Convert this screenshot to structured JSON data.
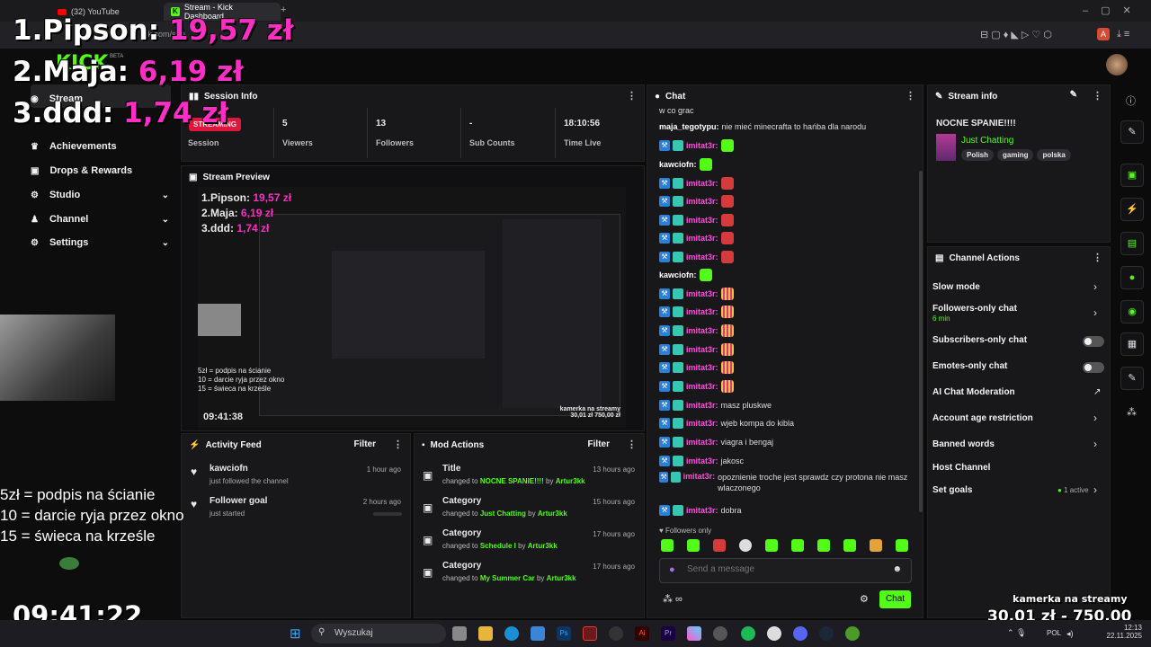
{
  "browser": {
    "tabs": [
      {
        "label": "(32) YouTube"
      },
      {
        "label": "Stream - Kick Dashboard"
      }
    ],
    "url_partial": "ck.com/stre"
  },
  "overlay": {
    "donors": [
      {
        "rank": "1.",
        "name": "Pipson:",
        "amount": "19,57 zł"
      },
      {
        "rank": "2.",
        "name": "Maja:",
        "amount": "6,19 zł"
      },
      {
        "rank": "3.",
        "name": "ddd:",
        "amount": "1,74 zł"
      }
    ],
    "rules": [
      "5zł = podpis na ścianie",
      "10 = darcie ryja przez okno",
      "15 = świeca na krześle"
    ],
    "clock": "09:41:22",
    "goal_title": "kamerka na streamy",
    "goal_current": "30,01 zł",
    "goal_sep": "-",
    "goal_target": "750,00 zł"
  },
  "sidebar": {
    "logo": "KICK",
    "logo_tag": "BETA",
    "items": [
      {
        "label": "Stream",
        "icon": "stream-icon",
        "expandable": false
      },
      {
        "label": "Achievements",
        "icon": "trophy-icon",
        "expandable": false
      },
      {
        "label": "Drops & Rewards",
        "icon": "gift-icon",
        "expandable": false
      },
      {
        "label": "Studio",
        "icon": "studio-icon",
        "expandable": true
      },
      {
        "label": "Channel",
        "icon": "channel-icon",
        "expandable": true
      },
      {
        "label": "Settings",
        "icon": "gear-icon",
        "expandable": true
      }
    ]
  },
  "session": {
    "title": "Session Info",
    "status": "STREAMING",
    "status_label": "Session",
    "stats": [
      {
        "value": "5",
        "label": "Viewers"
      },
      {
        "value": "13",
        "label": "Followers"
      },
      {
        "value": "-",
        "label": "Sub Counts"
      },
      {
        "value": "18:10:56",
        "label": "Time Live"
      }
    ]
  },
  "preview": {
    "title": "Stream Preview",
    "donors_mini": [
      "1.Pipson:",
      "2.Maja:",
      "3.ddd:"
    ],
    "amounts_mini": [
      "19,57 zł",
      "6,19 zł",
      "1,74 zł"
    ],
    "clock_mini": "09:41:38",
    "rules_mini": [
      "5zł = podpis na ścianie",
      "10 = darcie ryja przez okno",
      "15 = świeca na krześle"
    ],
    "goal_mini": "kamerka na streamy",
    "goal_amount_mini": "30,01 zł  750,00 zł"
  },
  "activity": {
    "title": "Activity Feed",
    "filter": "Filter",
    "items": [
      {
        "user": "kawciofn",
        "text": "just followed the channel",
        "time": "1 hour ago"
      },
      {
        "user": "Follower goal",
        "text": "just started",
        "time": "2 hours ago"
      }
    ]
  },
  "mod": {
    "title": "Mod Actions",
    "filter": "Filter",
    "items": [
      {
        "type": "Title",
        "prefix": "changed to",
        "value": "NOCNE SPANIE!!!!",
        "by": "by",
        "user": "Artur3kk",
        "time": "13 hours ago"
      },
      {
        "type": "Category",
        "prefix": "changed to",
        "value": "Just Chatting",
        "by": "by",
        "user": "Artur3kk",
        "time": "15 hours ago"
      },
      {
        "type": "Category",
        "prefix": "changed to",
        "value": "Schedule I",
        "by": "by",
        "user": "Artur3kk",
        "time": "17 hours ago"
      },
      {
        "type": "Category",
        "prefix": "changed to",
        "value": "My Summer Car",
        "by": "by",
        "user": "Artur3kk",
        "time": "17 hours ago"
      }
    ]
  },
  "chat": {
    "title": "Chat",
    "messages": [
      {
        "user": "",
        "text": "w co grac",
        "emote": ""
      },
      {
        "user": "maja_tegotypu:",
        "text": "nie mieć minecrafta to hańba dla narodu",
        "emote": ""
      },
      {
        "user": "imitat3r:",
        "text": "",
        "emote": "green"
      },
      {
        "user": "kawciofn:",
        "text": "",
        "emote": "green"
      },
      {
        "user": "imitat3r:",
        "text": "",
        "emote": "red"
      },
      {
        "user": "imitat3r:",
        "text": "",
        "emote": "red"
      },
      {
        "user": "imitat3r:",
        "text": "",
        "emote": "red"
      },
      {
        "user": "imitat3r:",
        "text": "",
        "emote": "red"
      },
      {
        "user": "imitat3r:",
        "text": "",
        "emote": "red"
      },
      {
        "user": "kawciofn:",
        "text": "",
        "emote": "green"
      },
      {
        "user": "imitat3r:",
        "text": "",
        "emote": "bars"
      },
      {
        "user": "imitat3r:",
        "text": "",
        "emote": "bars"
      },
      {
        "user": "imitat3r:",
        "text": "",
        "emote": "bars"
      },
      {
        "user": "imitat3r:",
        "text": "",
        "emote": "bars"
      },
      {
        "user": "imitat3r:",
        "text": "",
        "emote": "bars"
      },
      {
        "user": "imitat3r:",
        "text": "",
        "emote": "bars"
      },
      {
        "user": "imitat3r:",
        "text": "masz pluskwe",
        "emote": ""
      },
      {
        "user": "imitat3r:",
        "text": "wjeb kompa do kibla",
        "emote": ""
      },
      {
        "user": "imitat3r:",
        "text": "viagra i bengaj",
        "emote": ""
      },
      {
        "user": "imitat3r:",
        "text": "jakosc",
        "emote": ""
      },
      {
        "user": "imitat3r:",
        "text": "opoznienie troche jest sprawdz czy protona nie masz wlaczonego",
        "emote": ""
      },
      {
        "user": "imitat3r:",
        "text": "dobra",
        "emote": ""
      }
    ],
    "mode": "Followers only",
    "placeholder": "Send a message",
    "send": "Chat"
  },
  "stream_info": {
    "title": "Stream info",
    "stream_title": "NOCNE SPANIE!!!!",
    "category": "Just Chatting",
    "tags": [
      "Polish",
      "gaming",
      "polska"
    ]
  },
  "channel_actions": {
    "title": "Channel Actions",
    "items": [
      {
        "label": "Slow mode",
        "sub": "",
        "control": "chevron"
      },
      {
        "label": "Followers-only chat",
        "sub": "6 min",
        "control": "chevron"
      },
      {
        "label": "Subscribers-only chat",
        "sub": "",
        "control": "toggle"
      },
      {
        "label": "Emotes-only chat",
        "sub": "",
        "control": "toggle"
      },
      {
        "label": "AI Chat Moderation",
        "sub": "",
        "control": "external"
      },
      {
        "label": "Account age restriction",
        "sub": "",
        "control": "chevron"
      },
      {
        "label": "Banned words",
        "sub": "",
        "control": "chevron"
      },
      {
        "label": "Host Channel",
        "sub": "",
        "control": "none"
      },
      {
        "label": "Set goals",
        "sub": "",
        "control": "chevron",
        "badge": "1 active"
      }
    ]
  },
  "taskbar": {
    "search": "Wyszukaj",
    "lang": "POL",
    "time": "12:13",
    "date": "22.11.2025"
  },
  "colors": {
    "accent": "#53fc18",
    "donor_pink": "#ff2ec4",
    "chat_user": "#ff4ddc",
    "panel_bg": "#18181b"
  }
}
